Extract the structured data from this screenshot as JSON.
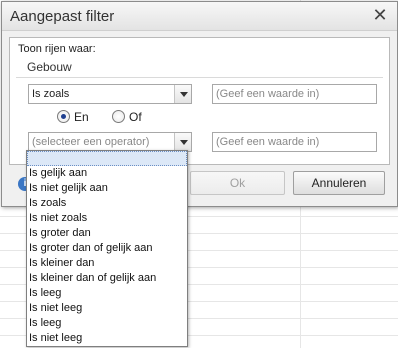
{
  "dialog": {
    "title": "Aangepast filter",
    "close_symbol": "✕",
    "show_rows_label": "Toon rijen waar:",
    "column_name": "Gebouw",
    "condition1": {
      "operator": "Is zoals",
      "value_placeholder": "(Geef een waarde in)"
    },
    "logic": {
      "and_label": "En",
      "or_label": "Of",
      "selected": "En"
    },
    "condition2": {
      "operator_placeholder": "(selecteer een operator)",
      "value_placeholder": "(Geef een waarde in)"
    },
    "buttons": {
      "ok": "Ok",
      "cancel": "Annuleren"
    }
  },
  "operator_dropdown": {
    "items": [
      "",
      "Is gelijk aan",
      "Is niet gelijk aan",
      "Is zoals",
      "Is niet zoals",
      "Is groter dan",
      "Is groter dan of gelijk aan",
      "Is kleiner dan",
      "Is kleiner dan of gelijk aan",
      "Is leeg",
      "Is niet leeg",
      "Is leeg",
      "Is niet leeg"
    ]
  }
}
